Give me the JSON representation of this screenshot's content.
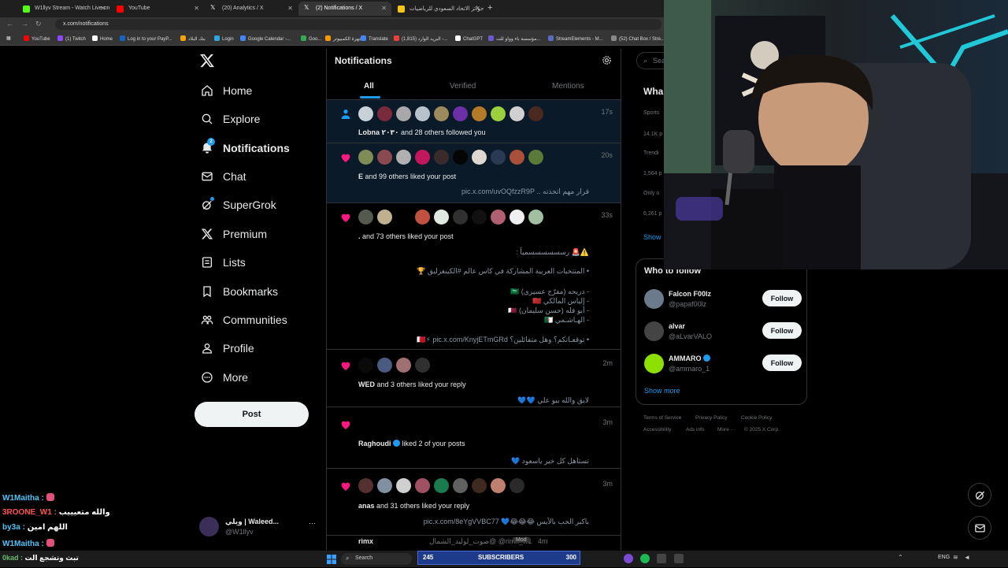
{
  "browser": {
    "tabs": [
      {
        "label": "W1llyv Stream - Watch Live on",
        "favicon_color": "#53fc18",
        "active": false
      },
      {
        "label": "YouTube",
        "favicon_color": "#ff0000",
        "active": false
      },
      {
        "label": "(20) Analytics / X",
        "favicon_color": "#ffffff",
        "active": false
      },
      {
        "label": "(2) Notifications / X",
        "favicon_color": "#ffffff",
        "active": true
      },
      {
        "label": "جوائز الاتحاد السعودي للرياضيات",
        "favicon_color": "#f5c518",
        "active": false
      }
    ],
    "url": "x.com/notifications",
    "bookmarks": [
      {
        "label": "YouTube",
        "color": "#ff0000"
      },
      {
        "label": "(1) Twitch",
        "color": "#9146ff"
      },
      {
        "label": "Home",
        "color": "#ffffff"
      },
      {
        "label": "Log in to your PayP...",
        "color": "#1565c0"
      },
      {
        "label": "بنك البلاد",
        "color": "#f0a500"
      },
      {
        "label": "Login",
        "color": "#2aa7df"
      },
      {
        "label": "Google Calendar -...",
        "color": "#4285f4"
      },
      {
        "label": "Goo...",
        "color": "#34a853"
      },
      {
        "label": "أجهزة الكمبيوتر",
        "color": "#ff9900"
      },
      {
        "label": "Translate",
        "color": "#4285f4"
      },
      {
        "label": "البريد الوارد (1,815) -...",
        "color": "#ea4335"
      },
      {
        "label": "ChatGPT",
        "color": "#ffffff"
      },
      {
        "label": "مؤسسة باء وواو للت...",
        "color": "#6a5acd"
      },
      {
        "label": "StreamElements - M...",
        "color": "#5c6bc0"
      },
      {
        "label": "(52) Chat Box / Stre...",
        "color": "#888888"
      }
    ]
  },
  "sidebar": {
    "logo": "x-logo-icon",
    "items": [
      {
        "label": "Home",
        "icon": "home-icon"
      },
      {
        "label": "Explore",
        "icon": "search-icon"
      },
      {
        "label": "Notifications",
        "icon": "bell-icon",
        "badge": "2",
        "active": true
      },
      {
        "label": "Chat",
        "icon": "mail-icon"
      },
      {
        "label": "SuperGrok",
        "icon": "grok-icon"
      },
      {
        "label": "Premium",
        "icon": "x-icon"
      },
      {
        "label": "Lists",
        "icon": "list-icon"
      },
      {
        "label": "Bookmarks",
        "icon": "bookmark-icon"
      },
      {
        "label": "Communities",
        "icon": "communities-icon"
      },
      {
        "label": "Profile",
        "icon": "profile-icon"
      },
      {
        "label": "More",
        "icon": "more-icon"
      }
    ],
    "post_label": "Post",
    "account": {
      "name": "ويلي | Waleed...",
      "handle": "@W1llyv"
    }
  },
  "notifications": {
    "title": "Notifications",
    "tabs": [
      "All",
      "Verified",
      "Mentions"
    ],
    "items": [
      {
        "kind": "follow",
        "time": "17s",
        "bold": "Lobna ٢٠٣٠",
        "text": " and 28 others followed you",
        "sub": ""
      },
      {
        "kind": "like",
        "time": "20s",
        "bold": "E",
        "text": " and 99 others liked your post",
        "sub": "قرار مهم اتخذته .. pic.x.com/uvOQfzzR9P"
      },
      {
        "kind": "like",
        "time": "33s",
        "bold": ".",
        "text": " and 73 others liked your post",
        "sub": ""
      },
      {
        "kind": "like",
        "time": "2m",
        "bold": "WED",
        "text": " and 3 others liked your reply",
        "sub": "لايق والله يبو علي 💙💙"
      },
      {
        "kind": "like",
        "time": "3m",
        "bold": "Raghoudi",
        "text": " liked 2 of your posts",
        "sub": "تستاهل كل خير ياسعود 💙"
      },
      {
        "kind": "like",
        "time": "3m",
        "bold": "anas",
        "text": " and 31 others liked your reply",
        "sub": "ياكبر الحب بالآيس 😂😂😂💙 pic.x.com/8eYgVVBC77"
      }
    ],
    "tweet_lines": [
      "⚠️🚨 رسسسسسسمياً :",
      "• المنتخبات العربية المشاركة في كاس عالم #الكينغزليق 🏆",
      "- دريحه (مفرّج عسيري) 🇸🇦",
      "- إلياس المالكي 🇲🇦",
      "- أبو فله (حسن سليمان) 🇶🇦",
      "- الهـاشـمي 🇩🇿",
      "• توقعـاتكم؟ وهل متفائلين؟ 🇧🇭⚡ pic.x.com/KnyjETmGRd"
    ],
    "reply_preview": {
      "name": "rimx",
      "handle": "صوت_لوليد_الشمال@ @rimx_w1",
      "badge": "Mod",
      "time": "4m"
    }
  },
  "right": {
    "search_placeholder": "Sea",
    "trends_title": "Wha",
    "trend_bits": [
      "Sports",
      "14.1K p",
      "Trendi",
      "1,564 p",
      "Only o",
      "6,261 p",
      "Show"
    ],
    "who_to_follow": {
      "title": "Who to follow",
      "accounts": [
        {
          "name": "Falcon F00lz",
          "handle": "@papaf00lz",
          "color": "#6b7b8c"
        },
        {
          "name": "alvar",
          "handle": "@aLvarVALO",
          "color": "#444444"
        },
        {
          "name": "AMMARO",
          "handle": "@ammaro_1",
          "color": "#8ee000",
          "verified": true
        }
      ],
      "follow_label": "Follow",
      "show_more": "Show more"
    },
    "footer": [
      "Terms of Service",
      "Privacy Policy",
      "Cookie Policy",
      "Accessibility",
      "Ads info",
      "More ···",
      "© 2025 X Corp."
    ]
  },
  "stream_chat": [
    {
      "user": "W1Maitha :",
      "msg": "",
      "color": "#4fc3f7"
    },
    {
      "user": "3ROONE_W1 :",
      "msg": "والله متعيييب",
      "color": "#ff5252"
    },
    {
      "user": "by3a :",
      "msg": "اللهم امين",
      "color": "#4fc3f7"
    },
    {
      "user": "W1Maitha :",
      "msg": "",
      "color": "#4fc3f7"
    },
    {
      "user": "0kad :",
      "msg": "تبث وتشجع الت",
      "color": "#66bb6a"
    }
  ],
  "taskbar": {
    "search": "Search",
    "subs_count": "245",
    "subs_label": "SUBSCRIBERS",
    "subs_goal": "300",
    "lang": "ENG"
  }
}
